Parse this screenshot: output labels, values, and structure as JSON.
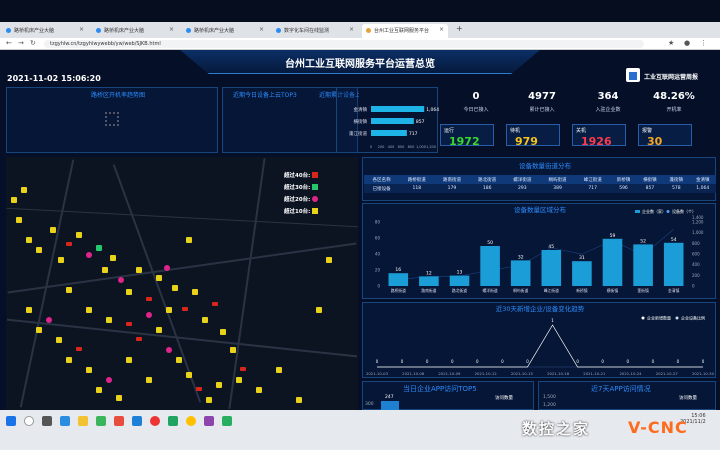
{
  "browser": {
    "tabs": [
      "路桥机床产业大脑",
      "路桥机床产业大脑",
      "路桥机床产业大脑",
      "数字化车间在线监测",
      "台州工业互联网服务平台"
    ],
    "url": "tzgyhlw.cn/tzgyhlwywebb/yw/web/SJKB.html"
  },
  "header": {
    "title": "台州工业互联网服务平台运营总览",
    "datetime": "2021-11-02 15:06:20",
    "report_link": "工业互联网运营周报"
  },
  "panels": {
    "district_title": "路桥区开机率趋势图",
    "top3_today_title": "近期今日设备上云TOP3",
    "top3_total_title": "近期累计设备上云TOP3"
  },
  "top3_bars": {
    "items": [
      {
        "name": "金清镇",
        "value": 1064
      },
      {
        "name": "横街镇",
        "value": 857
      },
      {
        "name": "蓬江街道",
        "value": 717
      }
    ],
    "axis": [
      "0",
      "200",
      "400",
      "600",
      "800",
      "1,000",
      "1,200"
    ]
  },
  "stats": [
    {
      "value": "0",
      "label": "今日已接入"
    },
    {
      "value": "4977",
      "label": "累计已接入"
    },
    {
      "value": "364",
      "label": "入驻企业数"
    },
    {
      "value": "48.26%",
      "label": "开机率"
    }
  ],
  "status": [
    {
      "label": "运行",
      "value": "1972",
      "color": "#38d82c"
    },
    {
      "label": "待机",
      "value": "979",
      "color": "#f5c21a"
    },
    {
      "label": "关机",
      "value": "1926",
      "color": "#ff3a4a"
    },
    {
      "label": "报警",
      "value": "30",
      "color": "#f5a623"
    }
  ],
  "legend": [
    {
      "label": "超过40台:",
      "shape": "flag-icon"
    },
    {
      "label": "超过30台:",
      "shape": "star-icon"
    },
    {
      "label": "超过20台:",
      "shape": "pentagon-icon"
    },
    {
      "label": "超过10台:",
      "shape": "square-icon"
    }
  ],
  "device_table": {
    "title": "设备数量街道分布",
    "headers": [
      "各区名称",
      "路桥街道",
      "路南街道",
      "路北街道",
      "螺洋街道",
      "桐屿街道",
      "峰江街道",
      "新桥镇",
      "横街镇",
      "蓬街镇",
      "金清镇"
    ],
    "row": [
      "已接设备",
      "118",
      "179",
      "186",
      "293",
      "389",
      "717",
      "596",
      "857",
      "578",
      "1,064"
    ]
  },
  "chart_data": [
    {
      "type": "bar",
      "title": "设备数量区域分布",
      "categories": [
        "路桥街道",
        "路南街道",
        "路北街道",
        "螺洋街道",
        "桐屿街道",
        "峰江街道",
        "新桥镇",
        "横街镇",
        "蓬街镇",
        "金清镇"
      ],
      "series": [
        {
          "name": "企业数（家）",
          "values": [
            16,
            12,
            13,
            50,
            32,
            45,
            31,
            59,
            52,
            54
          ]
        },
        {
          "name": "设备数（个）",
          "values": [
            118,
            179,
            186,
            293,
            389,
            717,
            596,
            857,
            578,
            1064
          ]
        }
      ],
      "y_left_ticks": [
        "0",
        "20",
        "40",
        "60",
        "80"
      ],
      "y_right_ticks": [
        "0",
        "200",
        "400",
        "600",
        "800",
        "1,000",
        "1,200"
      ],
      "y_right_unit": "1,400"
    },
    {
      "type": "line",
      "title": "近30天新增企业/设备变化趋势",
      "legend": [
        "企业新增数量",
        "企业设备比例"
      ],
      "x": [
        "2021-10-03",
        "2021-10-06",
        "2021-10-09",
        "2021-10-12",
        "2021-10-15",
        "2021-10-18",
        "2021-10-21",
        "2021-10-24",
        "2021-10-27",
        "2021-10-30"
      ],
      "labels": [
        "0",
        "0",
        "0",
        "0",
        "0",
        "0",
        "0",
        "1",
        "0",
        "0",
        "0",
        "0",
        "0",
        "0"
      ],
      "peak_label": "1"
    }
  ],
  "bottom": {
    "app_top5_title": "当日企业APP访问TOP5",
    "app_top5_value": "247",
    "app_top5_axis": "300",
    "app_top5_legend": "访问数量",
    "app7_title": "近7天APP访问情况",
    "app7_axis": [
      "1,500",
      "1,200"
    ],
    "app7_legend": "访问数量"
  },
  "taskbar": {
    "time": "15:06",
    "date": "2021/11/2"
  },
  "watermark": {
    "text": "数控之家",
    "brand": "V-CNC"
  }
}
